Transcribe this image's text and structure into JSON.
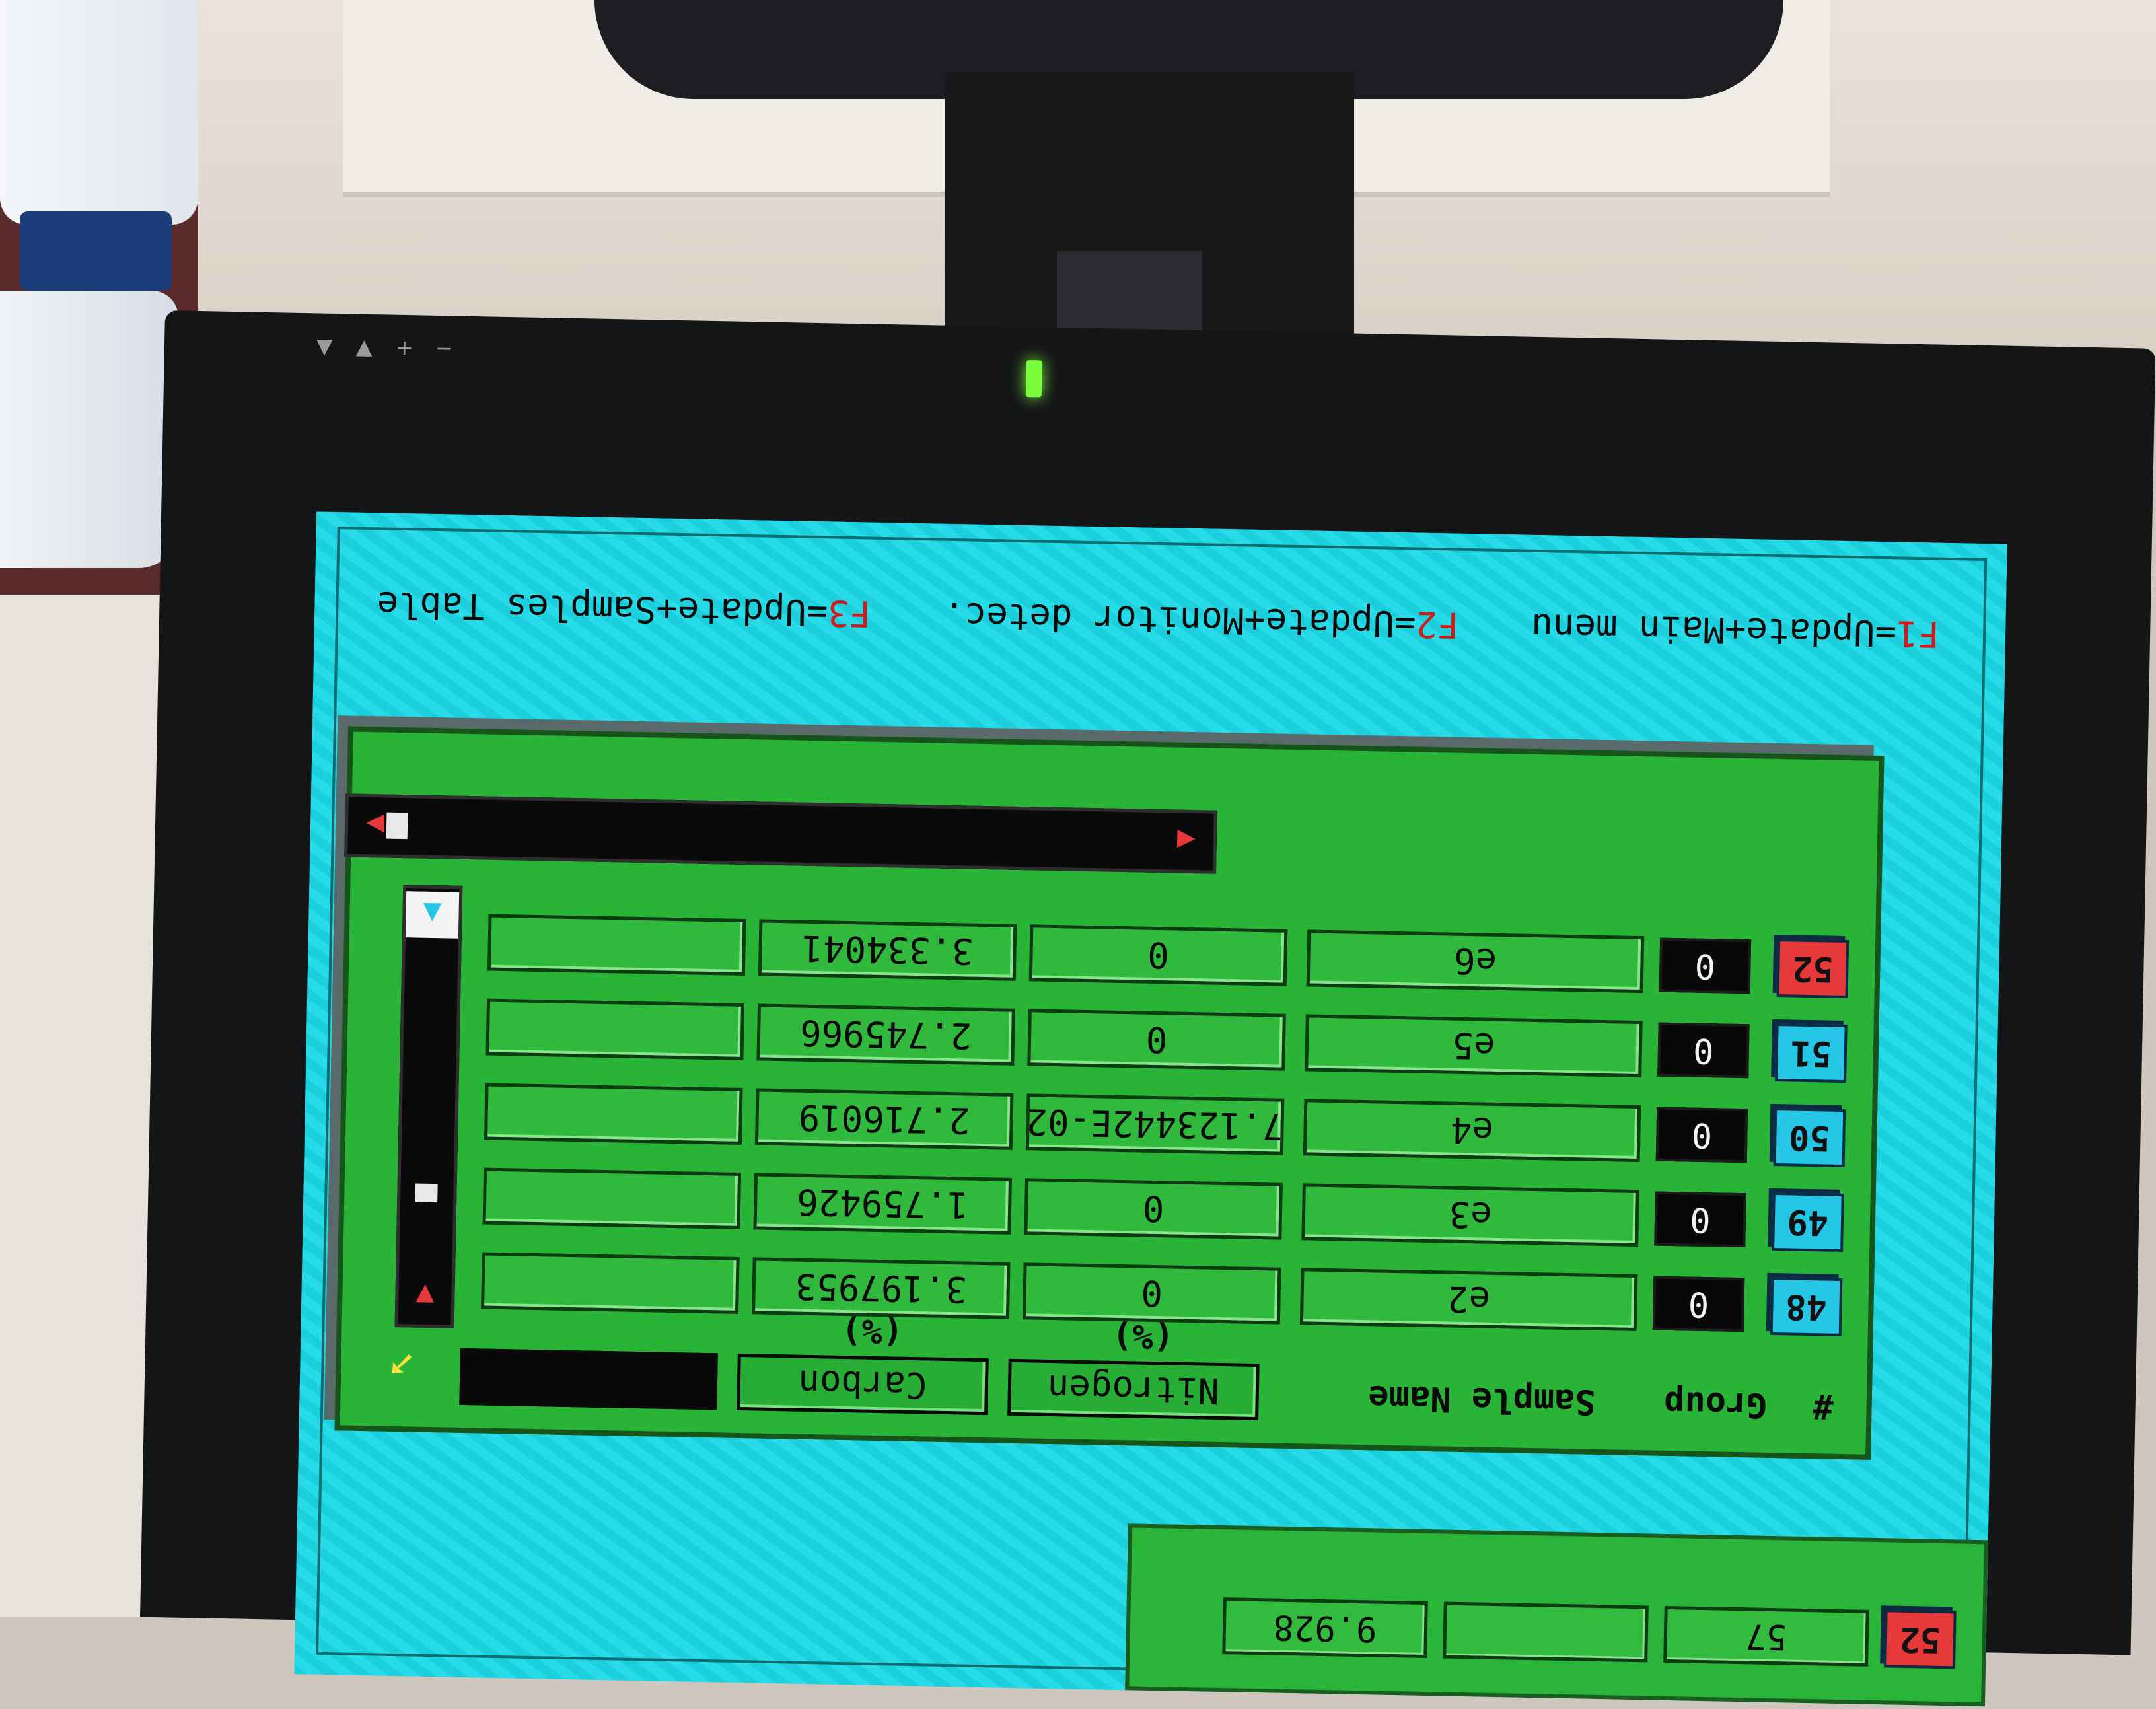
{
  "function_keys": [
    {
      "key": "F1",
      "text": "=Update+Main menu"
    },
    {
      "key": "F2",
      "text": "=Update+Monitor detec."
    },
    {
      "key": "F3",
      "text": "=Update+Samples Table"
    }
  ],
  "table": {
    "headers": {
      "number": "#",
      "group": "Group",
      "sample_name": "Sample Name",
      "nitrogen": "Nitrogen",
      "nitrogen_unit": "(%)",
      "carbon": "Carbon",
      "carbon_unit": "(%)"
    },
    "rows": [
      {
        "num": "48",
        "group": "0",
        "name": "e2",
        "nitrogen": "0",
        "carbon": "3.197953",
        "extra": ""
      },
      {
        "num": "49",
        "group": "0",
        "name": "e3",
        "nitrogen": "0",
        "carbon": "1.759426",
        "extra": ""
      },
      {
        "num": "50",
        "group": "0",
        "name": "e4",
        "nitrogen": "7.123442E-02",
        "carbon": "2.716019",
        "extra": ""
      },
      {
        "num": "51",
        "group": "0",
        "name": "e5",
        "nitrogen": "0",
        "carbon": "2.745966",
        "extra": ""
      },
      {
        "num": "52",
        "group": "0",
        "name": "e6",
        "nitrogen": "0",
        "carbon": "3.334041",
        "extra": ""
      }
    ],
    "active_row": "52"
  },
  "bottom_panel": {
    "num": "52",
    "value1": "57",
    "value2": "",
    "value3": "9.928"
  },
  "bezel": {
    "controls": [
      "▼",
      "▲",
      "+",
      "−"
    ]
  },
  "colors": {
    "screen_bg": "#1fd6e4",
    "panel_green": "#29b337",
    "active_badge": "#e63a3a",
    "badge_blue": "#25c6e6",
    "fkey_red": "#d21a1a"
  }
}
